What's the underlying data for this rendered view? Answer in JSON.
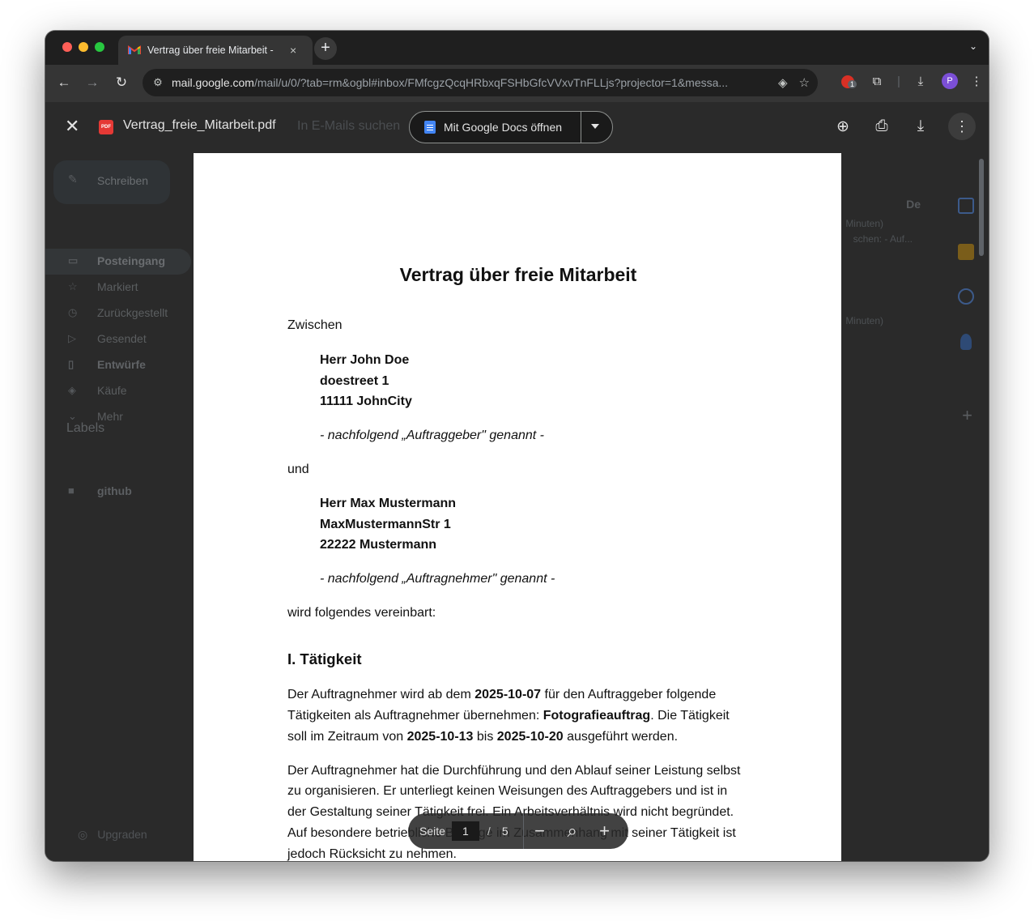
{
  "browser": {
    "tab_title": "Vertrag über freie Mitarbeit -",
    "tab_close": "×",
    "new_tab": "+",
    "tab_menu": "⌄",
    "url_host": "mail.google.com",
    "url_path": "/mail/u/0/?tab=rm&ogbl#inbox/FMfcgzQcqHRbxqFSHbGfcVVxvTnFLLjs?projector=1&messa...",
    "nav": {
      "back": "←",
      "forward": "→",
      "reload": "↻"
    },
    "extension_badge": "1",
    "profile_initial": "P"
  },
  "gmail_bg": {
    "compose": "Schreiben",
    "nav": [
      {
        "icon": "▭",
        "label": "Posteingang"
      },
      {
        "icon": "☆",
        "label": "Markiert"
      },
      {
        "icon": "◷",
        "label": "Zurückgestellt"
      },
      {
        "icon": "▷",
        "label": "Gesendet"
      },
      {
        "icon": "▯",
        "label": "Entwürfe"
      },
      {
        "icon": "◈",
        "label": "Käufe"
      },
      {
        "icon": "⌄",
        "label": "Mehr"
      }
    ],
    "labels_heading": "Labels",
    "label_github": "github",
    "upgrade": "Upgraden",
    "search_placeholder": "In E-Mails suchen",
    "right_lang": "De",
    "snippet1": "Minuten)",
    "snippet2": "schen: - Auf...",
    "snippet3": "Minuten)"
  },
  "viewer": {
    "close": "✕",
    "pdf_badge": "PDF",
    "filename": "Vertrag_freie_Mitarbeit.pdf",
    "open_with": "Mit Google Docs öffnen",
    "actions": {
      "add_drive": "⊕",
      "print": "⎙",
      "download": "⤓",
      "more": "⋮"
    }
  },
  "document": {
    "title": "Vertrag über freie Mitarbeit",
    "between": "Zwischen",
    "party1": {
      "name": "Herr John Doe",
      "street": "doestreet 1",
      "city": "11111 JohnCity",
      "role": "- nachfolgend „Auftraggeber\" genannt -"
    },
    "and": "und",
    "party2": {
      "name": "Herr Max Mustermann",
      "street": "MaxMustermannStr 1",
      "city": "22222 Mustermann",
      "role": "- nachfolgend „Auftragnehmer\" genannt -"
    },
    "agreed": "wird folgendes vereinbart:",
    "section1": "I. Tätigkeit",
    "para1": {
      "t1": "Der Auftragnehmer wird ab dem ",
      "start_date": "2025-10-07",
      "t2": " für den Auftraggeber folgende",
      "t3": "Tätigkeiten als Auftragnehmer übernehmen: ",
      "task": "Fotografieauftrag",
      "t4": ". Die Tätigkeit",
      "t5": "soll im Zeitraum von ",
      "from": "2025-10-13",
      "t6": " bis ",
      "to": "2025-10-20",
      "t7": " ausgeführt werden."
    },
    "para2": [
      "Der Auftragnehmer hat die Durchführung und den Ablauf seiner Leistung selbst",
      "zu organisieren. Er unterliegt keinen Weisungen des Auftraggebers und ist in",
      "der Gestaltung seiner Tätigkeit frei. Ein Arbeitsverhältnis wird nicht begründet.",
      "Auf besondere betriebliche Belange im Zusammenhang mit seiner Tätigkeit ist",
      "jedoch Rücksicht zu nehmen."
    ]
  },
  "pager": {
    "label": "Seite",
    "current": "1",
    "separator": "/",
    "total": "5",
    "zoom_out": "−",
    "zoom_fit": "⌕",
    "zoom_in": "+"
  }
}
